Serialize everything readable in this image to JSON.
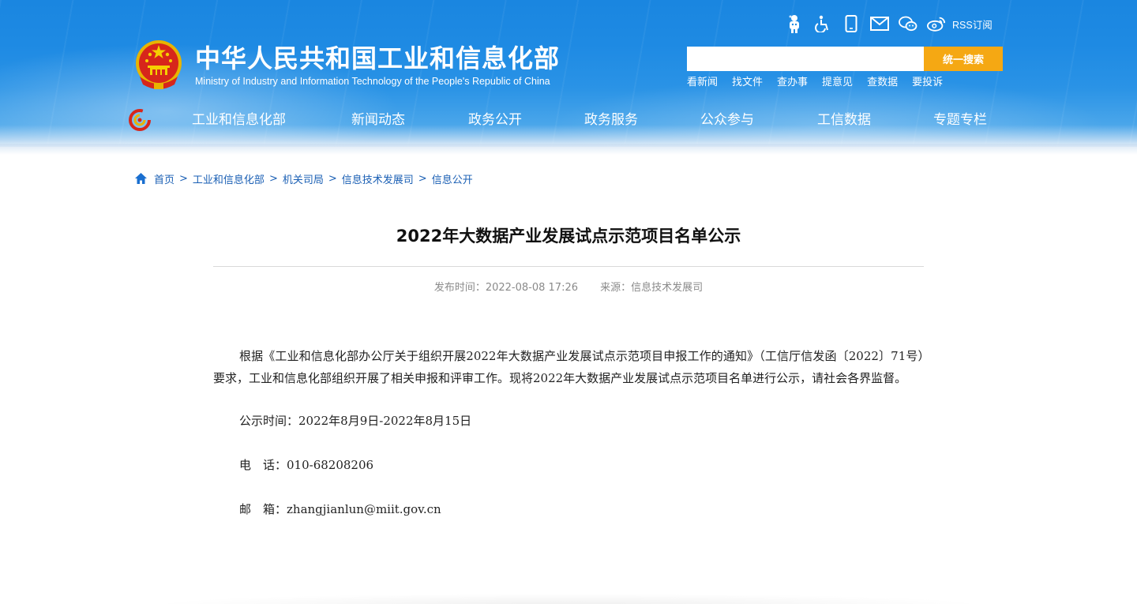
{
  "site": {
    "title": "中华人民共和国工业和信息化部",
    "subtitle": "Ministry of Industry and Information Technology of the People's Republic of China"
  },
  "top_icons": [
    {
      "name": "robot-assistant-icon"
    },
    {
      "name": "accessibility-icon"
    },
    {
      "name": "mobile-icon"
    },
    {
      "name": "mail-icon"
    },
    {
      "name": "wechat-icon"
    },
    {
      "name": "weibo-icon"
    }
  ],
  "rss_label": "RSS订阅",
  "search": {
    "placeholder": "",
    "button_label": "统一搜索"
  },
  "quick_links": [
    "看新闻",
    "找文件",
    "查办事",
    "提意见",
    "查数据",
    "要投诉"
  ],
  "nav": [
    "工业和信息化部",
    "新闻动态",
    "政务公开",
    "政务服务",
    "公众参与",
    "工信数据",
    "专题专栏"
  ],
  "breadcrumb": [
    "首页",
    "工业和信息化部",
    "机关司局",
    "信息技术发展司",
    "信息公开"
  ],
  "breadcrumb_separator": ">",
  "article": {
    "title": "2022年大数据产业发展试点示范项目名单公示",
    "publish_time": "发布时间：2022-08-08 17:26",
    "source": "来源：信息技术发展司",
    "paragraph": "根据《工业和信息化部办公厅关于组织开展2022年大数据产业发展试点示范项目申报工作的通知》（工信厅信发函〔2022〕71号）要求，工业和信息化部组织开展了相关申报和评审工作。现将2022年大数据产业发展试点示范项目名单进行公示，请社会各界监督。",
    "notice_period": "公示时间：2022年8月9日-2022年8月15日",
    "phone": "电　话：010-68208206",
    "email": "邮　箱：zhangjianlun@miit.gov.cn"
  },
  "colors": {
    "header_blue": "#1e8ae3",
    "search_button": "#f5a813",
    "link_blue": "#1a5fb4",
    "meta_gray": "#8a8a8a"
  }
}
